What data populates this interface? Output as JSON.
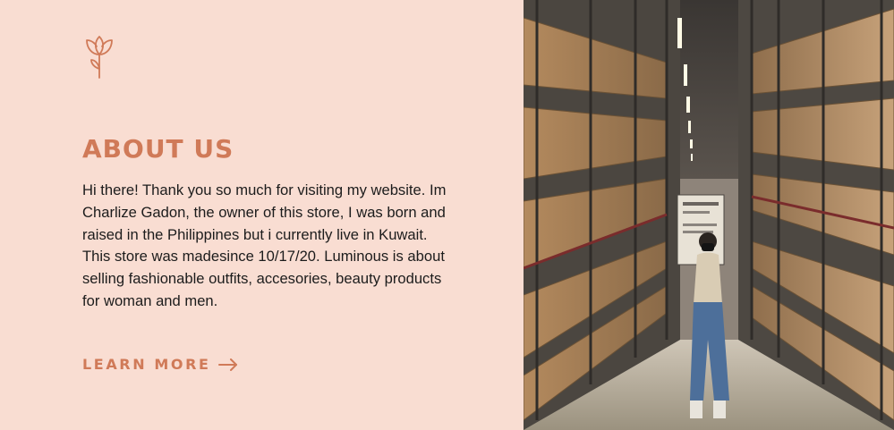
{
  "about": {
    "title": "ABOUT US",
    "body": "Hi there! Thank you so much for visiting my website. Im Charlize Gadon, the owner of this store, I was born and raised in the Philippines but i currently live in Kuwait. This store was madesince 10/17/20. Luminous is about selling fashionable outfits, accesories, beauty products for woman and men.",
    "cta_label": "LEARN MORE",
    "cta_icon": "arrow-right-icon",
    "logo_icon": "tulip-flower-icon"
  },
  "colors": {
    "background": "#f9ddd2",
    "accent": "#d07a58",
    "text": "#1c1c1c"
  },
  "photo": {
    "subject": "warehouse-aisle-photo"
  }
}
